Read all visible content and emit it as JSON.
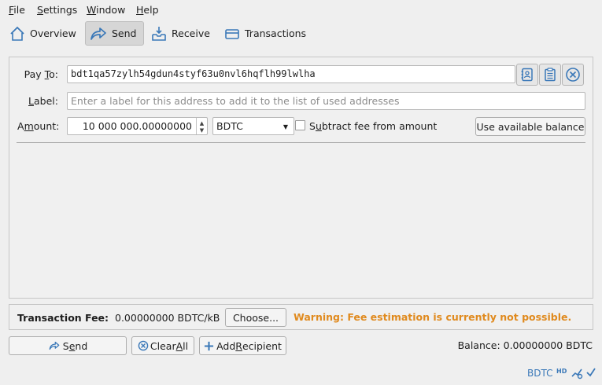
{
  "menu": {
    "file": "File",
    "file_mnemonic": "F",
    "file_rest": "ile",
    "settings": "Settings",
    "settings_mnemonic": "S",
    "settings_rest": "ettings",
    "window": "Window",
    "window_mnemonic": "W",
    "window_rest": "indow",
    "help": "Help",
    "help_mnemonic": "H",
    "help_rest": "elp"
  },
  "toolbar": {
    "overview": "Overview",
    "send": "Send",
    "receive": "Receive",
    "transactions": "Transactions",
    "active_tab": "Send"
  },
  "send_form": {
    "pay_to_label_pre": "Pay ",
    "pay_to_label_mnemonic": "T",
    "pay_to_label_post": "o:",
    "pay_to_value": "bdt1qa57zylh54gdun4styf63u0nvl6hqflh99lwlha",
    "label_label_mnemonic": "L",
    "label_label_rest": "abel:",
    "label_placeholder": "Enter a label for this address to add it to the list of used addresses",
    "amount_label_pre": "A",
    "amount_label_mnemonic": "m",
    "amount_label_post": "ount:",
    "amount_value": "10 000 000.00000000",
    "unit": "BDTC",
    "subtract_fee_pre": "S",
    "subtract_fee_mnemonic": "u",
    "subtract_fee_post": "btract fee from amount",
    "subtract_fee_checked": false,
    "use_available_balance": "Use available balance"
  },
  "fee": {
    "label": "Transaction Fee:",
    "value": "0.00000000 BDTC/kB",
    "choose_button": "Choose...",
    "warning": "Warning: Fee estimation is currently not possible."
  },
  "actions": {
    "send_pre": "S",
    "send_mnemonic": "e",
    "send_post": "nd",
    "clear_all_pre": "Clear ",
    "clear_all_mnemonic": "A",
    "clear_all_post": "ll",
    "add_recipient_pre": "Add ",
    "add_recipient_mnemonic": "R",
    "add_recipient_post": "ecipient",
    "balance": "Balance: 0.00000000 BDTC"
  },
  "status": {
    "unit": "BDTC",
    "hd": "HD"
  },
  "colors": {
    "accent": "#3a78b8",
    "warning": "#e08a1e"
  }
}
